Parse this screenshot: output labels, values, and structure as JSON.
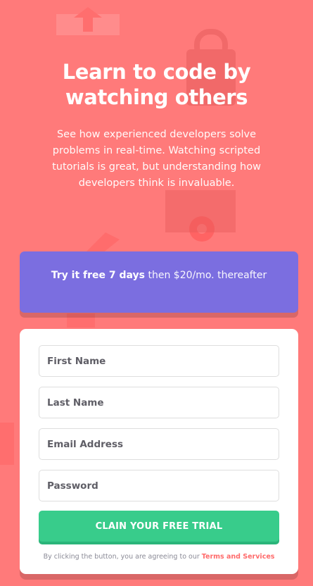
{
  "colors": {
    "background": "#ff7a7a",
    "promo": "#7b6ee0",
    "button": "#38cc8b",
    "link": "#ff6b6b"
  },
  "hero": {
    "title": "Learn to code by watching others",
    "description": "See how experienced developers solve problems in real-time. Watching scripted tutorials is great, but understanding how developers think is invaluable."
  },
  "promo": {
    "bold_text": "Try it free 7 days",
    "rest_text": " then $20/mo. thereafter"
  },
  "form": {
    "first_name_placeholder": "First Name",
    "last_name_placeholder": "Last Name",
    "email_placeholder": "Email Address",
    "password_placeholder": "Password",
    "submit_label": "CLAIN YOUR FREE TRIAL",
    "terms_text": "By clicking the button, you are agreeing to our ",
    "terms_link": "Terms and Services"
  },
  "icons": [
    "house-icon",
    "gear-icon",
    "lock-icon",
    "bracket-icon"
  ]
}
